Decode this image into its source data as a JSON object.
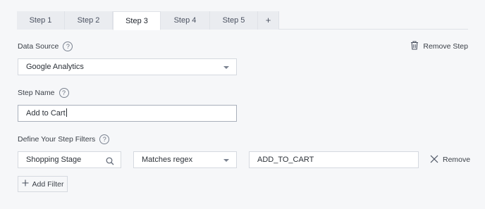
{
  "tabs": [
    {
      "label": "Step 1",
      "active": false
    },
    {
      "label": "Step 2",
      "active": false
    },
    {
      "label": "Step 3",
      "active": true
    },
    {
      "label": "Step 4",
      "active": false
    },
    {
      "label": "Step 5",
      "active": false
    },
    {
      "label": "+",
      "active": false
    }
  ],
  "remove_step_label": "Remove Step",
  "data_source": {
    "label": "Data Source",
    "help": "?",
    "value": "Google Analytics"
  },
  "step_name": {
    "label": "Step Name",
    "help": "?",
    "value": "Add to Cart"
  },
  "filters": {
    "label": "Define Your Step Filters",
    "help": "?",
    "field_value": "Shopping Stage",
    "operator_value": "Matches regex",
    "match_value": "ADD_TO_CART",
    "remove_label": "Remove",
    "add_filter_label": "Add Filter"
  },
  "icons": {
    "remove_step": "trash-icon",
    "help": "question-icon",
    "field_search": "search-icon",
    "remove_filter": "close-icon",
    "add_filter": "plus-icon",
    "dropdown": "caret-down-icon"
  },
  "colors": {
    "background": "#f6f7f9",
    "tab_inactive": "#eaecf0",
    "tab_active": "#ffffff",
    "border": "#d5d9df",
    "text": "#3b4048"
  }
}
